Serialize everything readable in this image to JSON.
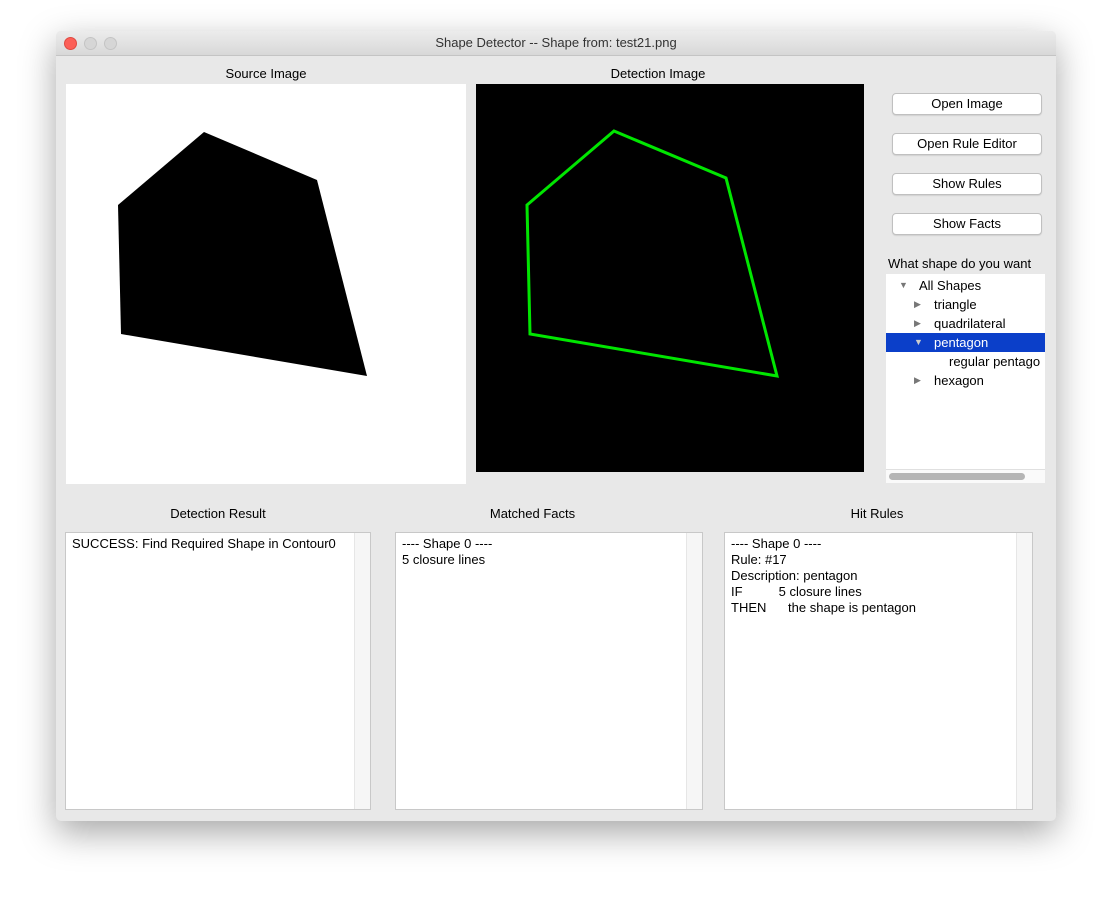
{
  "window": {
    "title": "Shape Detector -- Shape from: test21.png"
  },
  "labels": {
    "source": "Source Image",
    "detection": "Detection Image",
    "result": "Detection Result",
    "facts": "Matched Facts",
    "rules": "Hit Rules",
    "tree": "What shape do you want"
  },
  "buttons": {
    "open_image": "Open Image",
    "open_rule_editor": "Open Rule Editor",
    "show_rules": "Show Rules",
    "show_facts": "Show Facts"
  },
  "tree": {
    "items": [
      {
        "label": "All Shapes",
        "state": "expanded"
      },
      {
        "label": "triangle",
        "state": "collapsed"
      },
      {
        "label": "quadrilateral",
        "state": "collapsed"
      },
      {
        "label": "pentagon",
        "state": "expanded",
        "selected": true
      },
      {
        "label": "regular pentago"
      },
      {
        "label": "hexagon",
        "state": "collapsed"
      }
    ]
  },
  "result": {
    "lines": [
      "SUCCESS: Find Required Shape in Contour0"
    ]
  },
  "facts": {
    "lines": [
      "---- Shape 0 ----",
      "5 closure lines"
    ]
  },
  "rules": {
    "lines": [
      "---- Shape 0 ----",
      "Rule: #17",
      "Description: pentagon",
      "IF          5 closure lines",
      "THEN      the shape is pentagon"
    ]
  },
  "colors": {
    "detection_outline": "#00e600",
    "selection": "#0b3fc9"
  }
}
